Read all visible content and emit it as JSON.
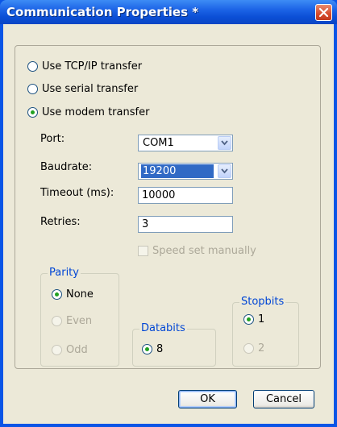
{
  "window": {
    "title": "Communication Properties *"
  },
  "transfer": {
    "options": [
      {
        "label": "Use TCP/IP transfer",
        "selected": false
      },
      {
        "label": "Use serial transfer",
        "selected": false
      },
      {
        "label": "Use modem transfer",
        "selected": true
      }
    ]
  },
  "form": {
    "port_label": "Port:",
    "port_value": "COM1",
    "baudrate_label": "Baudrate:",
    "baudrate_value": "19200",
    "timeout_label": "Timeout (ms):",
    "timeout_value": "10000",
    "retries_label": "Retries:",
    "retries_value": "3",
    "speed_manual_label": "Speed set manually",
    "speed_manual_checked": false
  },
  "parity": {
    "legend": "Parity",
    "options": [
      {
        "label": "None",
        "selected": true,
        "enabled": true
      },
      {
        "label": "Even",
        "selected": false,
        "enabled": false
      },
      {
        "label": "Odd",
        "selected": false,
        "enabled": false
      }
    ]
  },
  "databits": {
    "legend": "Databits",
    "options": [
      {
        "label": "8",
        "selected": true,
        "enabled": true
      }
    ]
  },
  "stopbits": {
    "legend": "Stopbits",
    "options": [
      {
        "label": "1",
        "selected": true,
        "enabled": true
      },
      {
        "label": "2",
        "selected": false,
        "enabled": false
      }
    ]
  },
  "buttons": {
    "ok": "OK",
    "cancel": "Cancel"
  },
  "colors": {
    "title_bar": "#0a55e6",
    "group_legend": "#0046d5",
    "dialog_bg": "#ece9d8",
    "radio_dot": "#21a121"
  },
  "icons": {
    "close": "close-x-icon",
    "combo_arrow": "chevron-down-icon"
  }
}
